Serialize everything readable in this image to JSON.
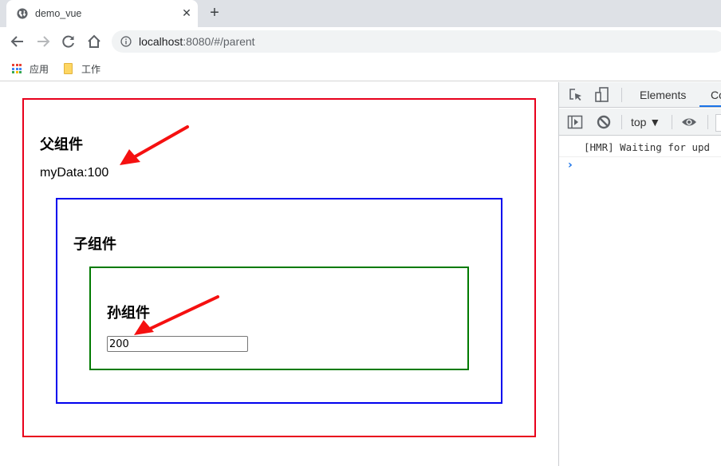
{
  "browser": {
    "tab": {
      "title": "demo_vue",
      "favicon": "globe-icon",
      "close_glyph": "✕"
    },
    "new_tab_glyph": "+",
    "nav": {
      "back": "arrow-left-icon",
      "forward": "arrow-right-icon",
      "reload": "reload-icon",
      "home": "home-icon"
    },
    "omnibox": {
      "host": "localhost",
      "rest": ":8080/#/parent",
      "info_icon": "info-icon"
    },
    "bookmarks": [
      {
        "label": "应用",
        "icon": "apps-grid-icon"
      },
      {
        "label": "工作",
        "icon": "folder-icon"
      }
    ]
  },
  "page": {
    "parent": {
      "heading": "父组件",
      "data_text": "myData:100",
      "border_color": "#e8001c"
    },
    "child": {
      "heading": "子组件",
      "border_color": "#0000ee"
    },
    "grandchild": {
      "heading": "孙组件",
      "input_value": "200",
      "border_color": "#007a00"
    },
    "annotation_color": "#f51010"
  },
  "devtools": {
    "tabs": [
      {
        "label": "Elements",
        "active": false
      },
      {
        "label": "Co",
        "active": true
      }
    ],
    "context_selector": "top ▼",
    "console_messages": [
      "[HMR] Waiting for upd"
    ],
    "prompt_glyph": "›"
  }
}
